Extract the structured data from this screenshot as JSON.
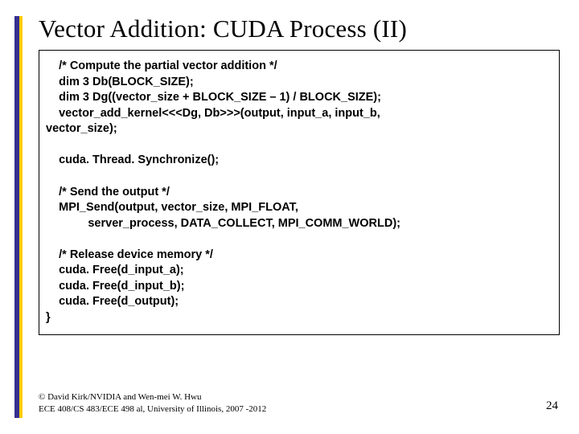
{
  "accent": {
    "color_a": "#353090",
    "color_b": "#ffcc00"
  },
  "title": "Vector Addition: CUDA Process (II)",
  "code_lines": [
    "    /* Compute the partial vector addition */",
    "    dim 3 Db(BLOCK_SIZE);",
    "    dim 3 Dg((vector_size + BLOCK_SIZE – 1) / BLOCK_SIZE);",
    "    vector_add_kernel<<<Dg, Db>>>(output, input_a, input_b,",
    "vector_size);",
    "",
    "    cuda. Thread. Synchronize();",
    "",
    "    /* Send the output */",
    "    MPI_Send(output, vector_size, MPI_FLOAT,",
    "             server_process, DATA_COLLECT, MPI_COMM_WORLD);",
    "",
    "    /* Release device memory */",
    "    cuda. Free(d_input_a);",
    "    cuda. Free(d_input_b);",
    "    cuda. Free(d_output);",
    "}"
  ],
  "footer": {
    "line1": "© David Kirk/NVIDIA and Wen-mei W. Hwu",
    "line2": "ECE 408/CS 483/ECE 498 al, University of Illinois, 2007 -2012"
  },
  "page_number": "24"
}
